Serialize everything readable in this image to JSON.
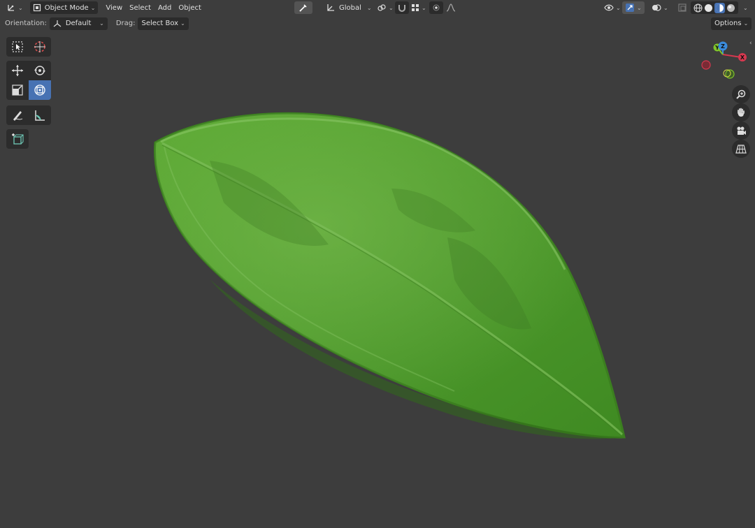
{
  "header": {
    "editor_type_icon": "3d-viewport-icon",
    "mode_label": "Object Mode",
    "menus": [
      "View",
      "Select",
      "Add",
      "Object"
    ],
    "transform_orientation": "Global"
  },
  "tool_settings": {
    "orientation_label": "Orientation:",
    "orientation_value": "Default",
    "drag_label": "Drag:",
    "drag_value": "Select Box",
    "options_label": "Options"
  },
  "toolbar": {
    "tools": [
      "select-box",
      "cursor",
      "move",
      "rotate",
      "scale",
      "transform",
      "annotate",
      "measure",
      "add-cube"
    ],
    "active_tool": "transform"
  },
  "gizmo": {
    "x_label": "X",
    "y_label": "Y",
    "z_label": "Z"
  },
  "colors": {
    "viewport_bg": "#3d3d3d",
    "active_tool": "#4772b3",
    "leaf_green": "#4f9a2c",
    "axis_x": "#d6384f",
    "axis_y": "#7fc42a",
    "axis_z": "#3b8cdc"
  }
}
